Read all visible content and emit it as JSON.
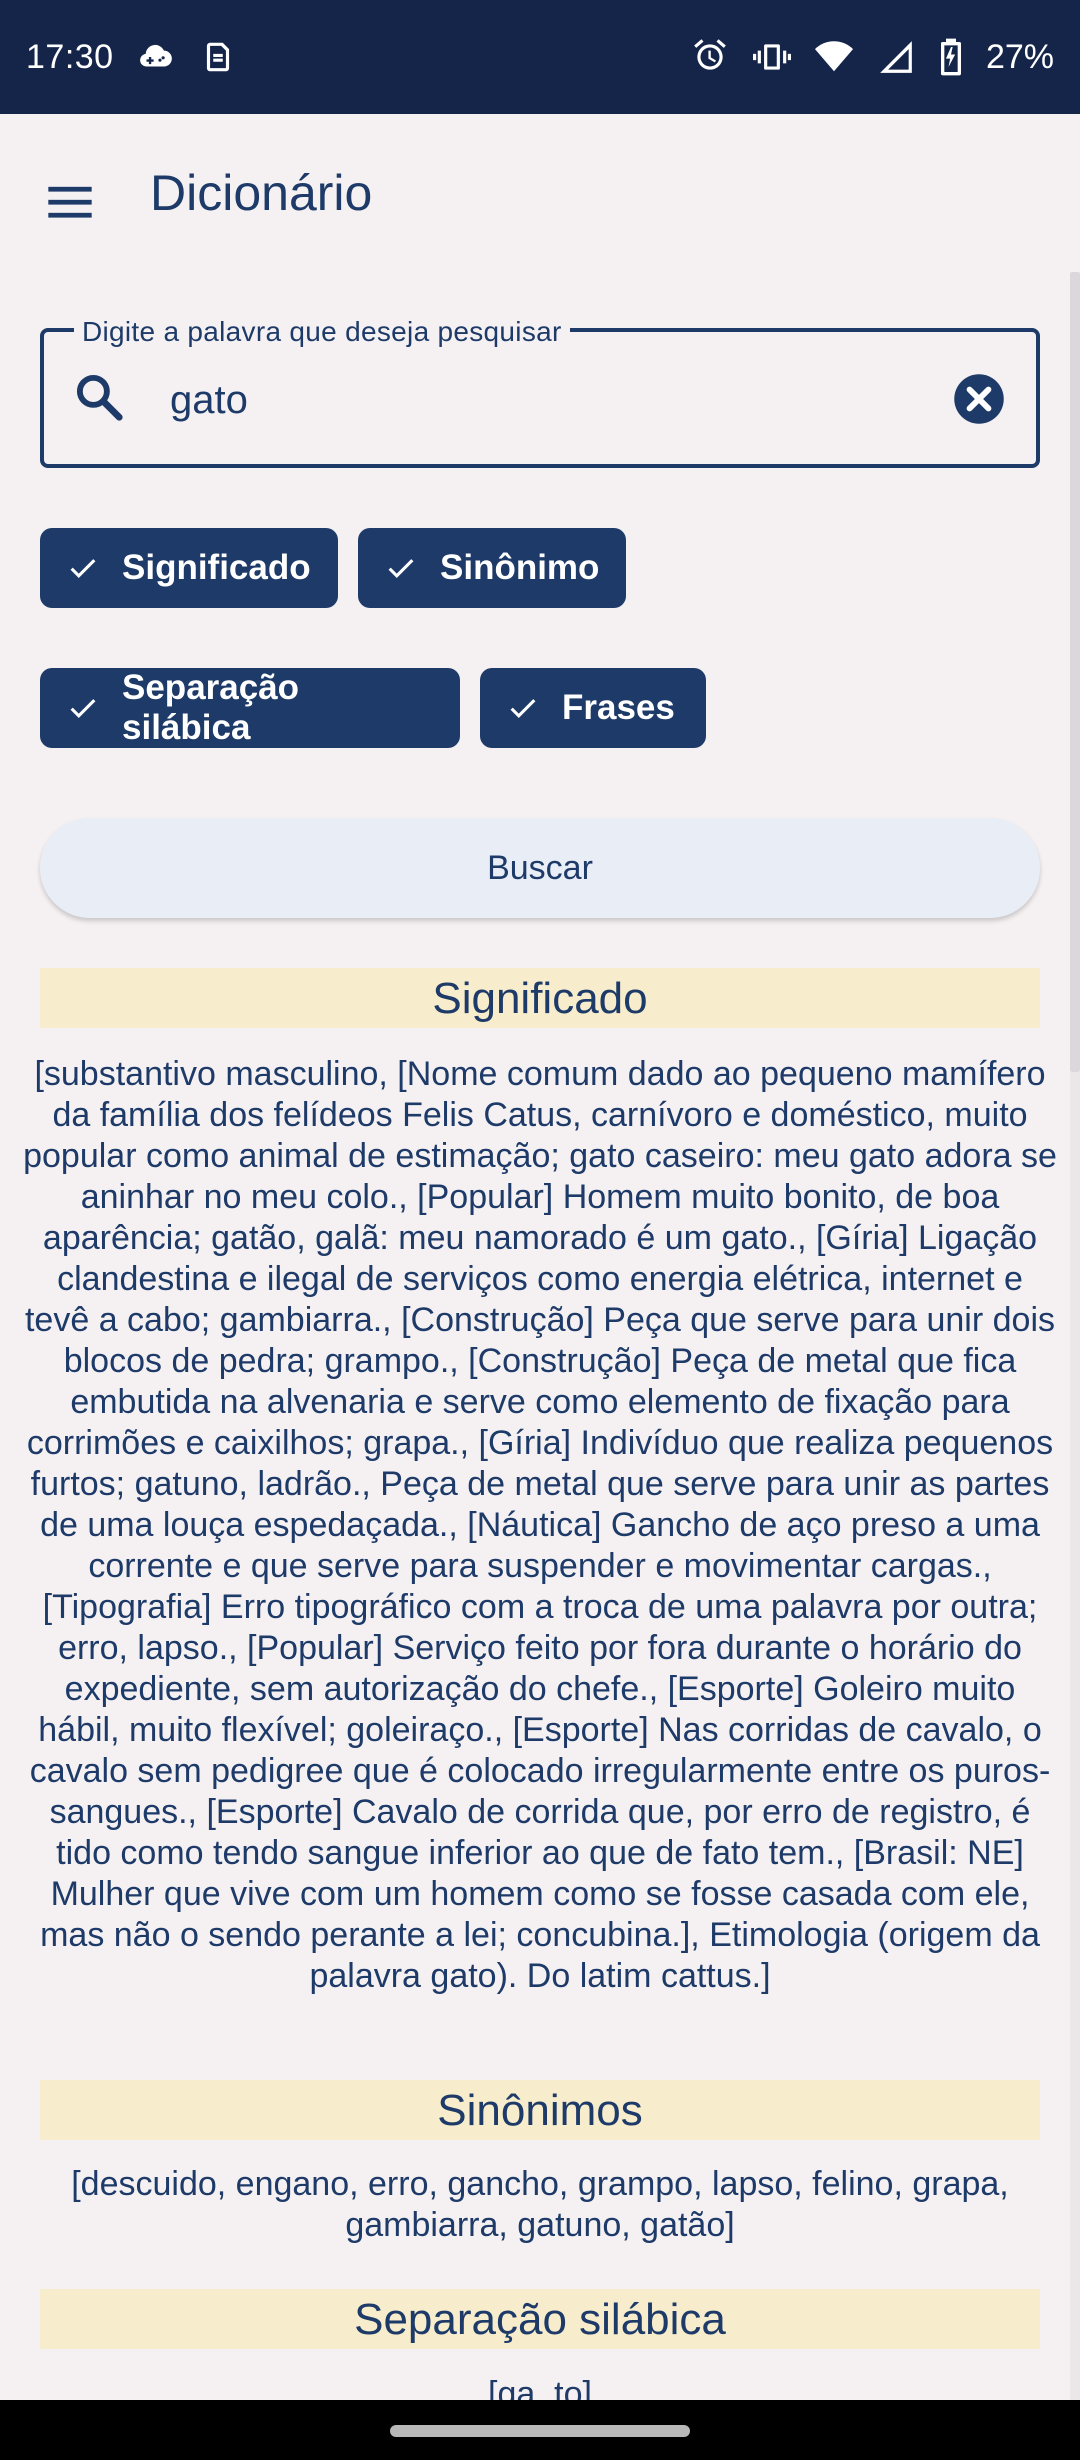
{
  "status_bar": {
    "time": "17:30",
    "battery": "27%",
    "icons": [
      "cloud-game-icon",
      "sim-icon",
      "alarm-icon",
      "vibrate-icon",
      "wifi-icon",
      "signal-icon",
      "battery-charging-icon"
    ]
  },
  "app_bar": {
    "title": "Dicionário",
    "menu_icon": "hamburger-menu-icon"
  },
  "search": {
    "label": "Digite a palavra que deseja pesquisar",
    "value": "gato",
    "placeholder": ""
  },
  "filters": [
    {
      "label": "Significado",
      "selected": true
    },
    {
      "label": "Sinônimo",
      "selected": true
    },
    {
      "label": "Separação silábica",
      "selected": true
    },
    {
      "label": "Frases",
      "selected": true
    }
  ],
  "buscar_label": "Buscar",
  "results": {
    "significado_title": "Significado",
    "significado_text": "[substantivo masculino, [Nome comum dado ao pequeno mamífero da família dos felídeos Felis Catus, carnívoro e doméstico, muito popular como animal de estimação; gato caseiro: meu gato adora se aninhar no meu colo., [Popular] Homem muito bonito, de boa aparência; gatão, galã: meu namorado é um gato., [Gíria] Ligação clandestina e ilegal de serviços como energia elétrica, internet e tevê a cabo; gambiarra., [Construção] Peça que serve para unir dois blocos de pedra; grampo., [Construção] Peça de metal que fica embutida na alvenaria e serve como elemento de fixação para corrimões e caixilhos; grapa., [Gíria] Indivíduo que realiza pequenos furtos; gatuno, ladrão., Peça de metal que serve para unir as partes de uma louça espedaçada., [Náutica] Gancho de aço preso a uma corrente e que serve para suspender e movimentar cargas., [Tipografia] Erro tipográfico com a troca de uma palavra por outra; erro, lapso., [Popular] Serviço feito por fora durante o horário do expediente, sem autorização do chefe., [Esporte] Goleiro muito hábil, muito flexível; goleiraço., [Esporte] Nas corridas de cavalo, o cavalo sem pedigree que é colocado irregularmente entre os puros-sangues., [Esporte] Cavalo de corrida que, por erro de registro, é tido como tendo sangue inferior ao que de fato tem., [Brasil: NE] Mulher que vive com um homem como se fosse casada com ele, mas não o sendo perante a lei; concubina.], Etimologia (origem da palavra gato). Do latim cattus.]",
    "sinonimos_title": "Sinônimos",
    "sinonimos_text": "[descuido, engano, erro, gancho, grampo, lapso, felino, grapa, gambiarra, gatuno, gatão]",
    "separacao_title": "Separação silábica",
    "separacao_text": "[ga, to]"
  },
  "colors": {
    "primary": "#1d3a68",
    "status_bar": "#15254a",
    "background": "#f5f1f2",
    "section_header": "#f7eccb",
    "button_bg": "#e9edf6"
  }
}
